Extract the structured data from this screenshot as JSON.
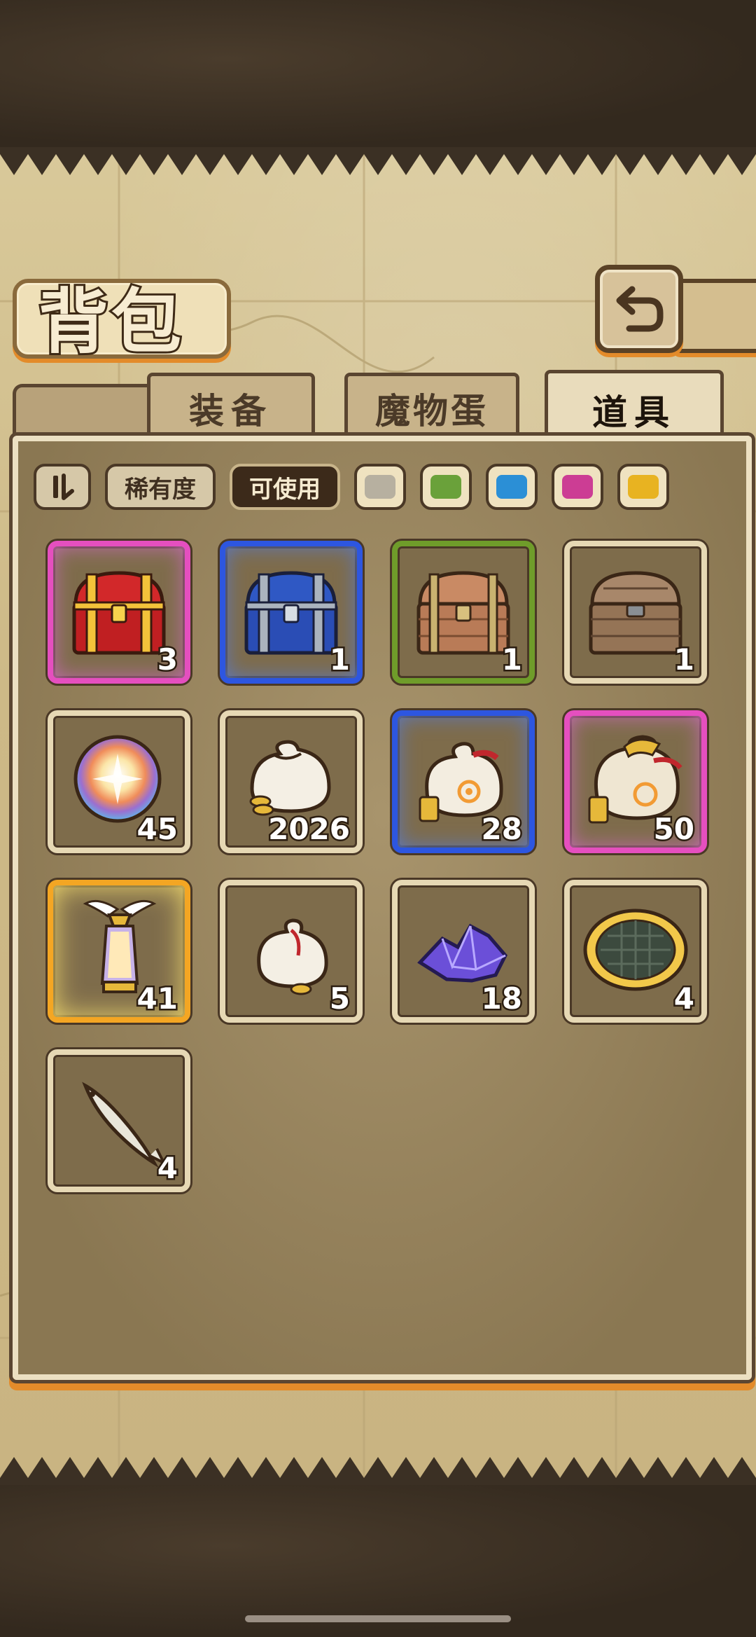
{
  "header": {
    "title": "背包"
  },
  "tabs": [
    {
      "label": "装备",
      "active": false
    },
    {
      "label": "魔物蛋",
      "active": false
    },
    {
      "label": "道具",
      "active": true
    }
  ],
  "filters": {
    "rarity_label": "稀有度",
    "usable_label": "可使用",
    "color_swatches": [
      "#b7b0a0",
      "#6aa13a",
      "#2b8fd6",
      "#cc3d94",
      "#e8b321"
    ]
  },
  "items": [
    {
      "icon": "red-treasure-chest-icon",
      "count": "3",
      "rarity": "purple"
    },
    {
      "icon": "blue-treasure-chest-icon",
      "count": "1",
      "rarity": "blue"
    },
    {
      "icon": "wooden-treasure-chest-icon",
      "count": "1",
      "rarity": "green"
    },
    {
      "icon": "plain-wooden-chest-icon",
      "count": "1",
      "rarity": "white"
    },
    {
      "icon": "rainbow-orb-icon",
      "count": "45",
      "rarity": "white"
    },
    {
      "icon": "small-coin-sack-icon",
      "count": "2026",
      "rarity": "white"
    },
    {
      "icon": "medium-coin-sack-icon",
      "count": "28",
      "rarity": "blue"
    },
    {
      "icon": "large-coin-sack-icon",
      "count": "50",
      "rarity": "purple"
    },
    {
      "icon": "winged-lantern-icon",
      "count": "41",
      "rarity": "gold"
    },
    {
      "icon": "tied-coin-sack-icon",
      "count": "5",
      "rarity": "white"
    },
    {
      "icon": "purple-crystal-icon",
      "count": "18",
      "rarity": "white"
    },
    {
      "icon": "waffle-cookie-icon",
      "count": "4",
      "rarity": "white"
    },
    {
      "icon": "fish-icon",
      "count": "4",
      "rarity": "white"
    }
  ]
}
